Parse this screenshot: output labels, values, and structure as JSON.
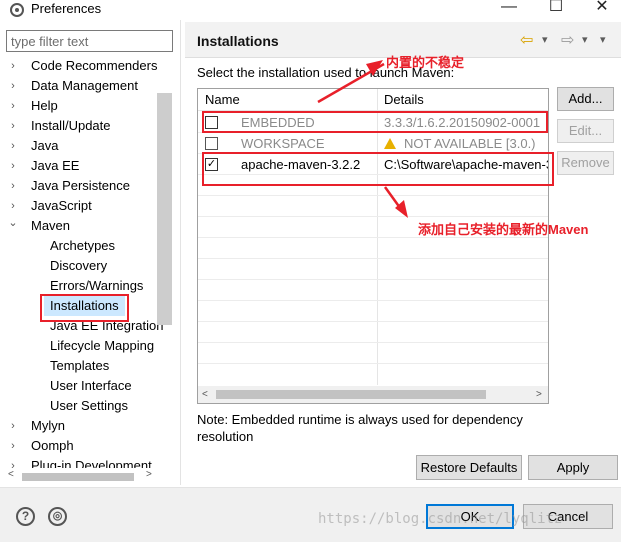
{
  "window": {
    "title": "Preferences",
    "minimize": "—",
    "maximize": "☐",
    "close": "✕"
  },
  "sidebar": {
    "filter_placeholder": "type filter text",
    "items": [
      {
        "label": "Code Recommenders",
        "chevron": "›"
      },
      {
        "label": "Data Management",
        "chevron": "›"
      },
      {
        "label": "Help",
        "chevron": "›"
      },
      {
        "label": "Install/Update",
        "chevron": "›"
      },
      {
        "label": "Java",
        "chevron": "›"
      },
      {
        "label": "Java EE",
        "chevron": "›"
      },
      {
        "label": "Java Persistence",
        "chevron": "›"
      },
      {
        "label": "JavaScript",
        "chevron": "›"
      },
      {
        "label": "Maven",
        "chevron": "⌄"
      },
      {
        "label": "Archetypes"
      },
      {
        "label": "Discovery"
      },
      {
        "label": "Errors/Warnings"
      },
      {
        "label": "Installations"
      },
      {
        "label": "Java EE Integration"
      },
      {
        "label": "Lifecycle Mapping"
      },
      {
        "label": "Templates"
      },
      {
        "label": "User Interface"
      },
      {
        "label": "User Settings"
      },
      {
        "label": "Mylyn",
        "chevron": "›"
      },
      {
        "label": "Oomph",
        "chevron": "›"
      },
      {
        "label": "Plug-in Development",
        "chevron": "›"
      }
    ],
    "selected": "Installations"
  },
  "header": {
    "title": "Installations",
    "back_icon": "⇦",
    "forward_icon": "⇨",
    "menu_icon": "▾"
  },
  "main": {
    "instruction": "Select the installation used to launch Maven:",
    "table": {
      "columns": [
        "Name",
        "Details"
      ],
      "rows": [
        {
          "checked": false,
          "name": "EMBEDDED",
          "details": "3.3.3/1.6.2.20150902-0001",
          "disabled": true
        },
        {
          "checked": false,
          "name": "WORKSPACE",
          "details": "NOT AVAILABLE [3.0.)",
          "disabled": true,
          "warning": true
        },
        {
          "checked": true,
          "name": "apache-maven-3.2.2",
          "details": "C:\\Software\\apache-maven-3",
          "disabled": false
        }
      ]
    },
    "buttons": {
      "add": "Add...",
      "edit": "Edit...",
      "remove": "Remove"
    },
    "note": "Note: Embedded runtime is always used for dependency resolution",
    "restore_defaults": "Restore Defaults",
    "apply": "Apply"
  },
  "footer": {
    "help_icon": "?",
    "import_icon": "◎",
    "ok": "OK",
    "cancel": "Cancel"
  },
  "annotations": {
    "embedded_note": "内置的不稳定",
    "added_note": "添加自己安装的最新的Maven",
    "color": "#e8202a"
  },
  "watermark": "https://blog.csdn.net/lyqlitz"
}
